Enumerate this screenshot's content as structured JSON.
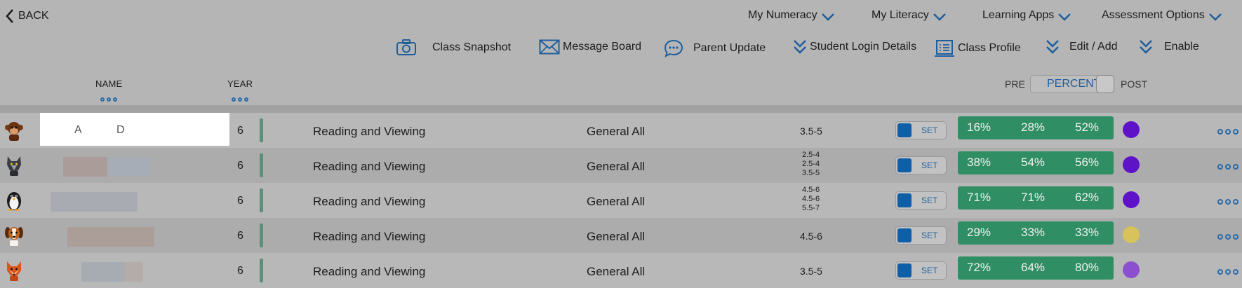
{
  "nav": {
    "back_label": "BACK"
  },
  "topmenu": [
    {
      "label": "My Numeracy"
    },
    {
      "label": "My Literacy"
    },
    {
      "label": "Learning Apps"
    },
    {
      "label": "Assessment Options"
    }
  ],
  "toolbar": [
    {
      "label": "Class Snapshot",
      "icon": "camera-icon"
    },
    {
      "label": "Message Board",
      "icon": "envelope-icon"
    },
    {
      "label": "Parent Update",
      "icon": "chat-bubble-icon"
    },
    {
      "label": "Student Login Details",
      "icon": "double-chevron-down-icon"
    },
    {
      "label": "Class Profile",
      "icon": "clipboard-list-icon"
    },
    {
      "label": "Edit / Add",
      "icon": "double-chevron-down-icon"
    },
    {
      "label": "Enable",
      "icon": "double-chevron-down-icon"
    }
  ],
  "columns": {
    "name": "NAME",
    "year": "YEAR"
  },
  "score_view": {
    "pre": "PRE",
    "mode": "PERCENT",
    "post": "POST"
  },
  "colors": {
    "accent": "#2a6ba8",
    "toggle_blue": "#0f5ea8",
    "score_green": "#2f8e63",
    "strand_bar": "#5a8f7a"
  },
  "rows": [
    {
      "avatar": "monkey-avatar",
      "name_initials": [
        "A",
        "D"
      ],
      "year": "6",
      "strand": "Reading and Viewing",
      "set": "General All",
      "levels": [
        "3.5-5"
      ],
      "toggle": "SET",
      "scores": [
        "16%",
        "28%",
        "52%"
      ],
      "status_color": "#5f13c8"
    },
    {
      "avatar": "wolf-avatar",
      "year": "6",
      "strand": "Reading and Viewing",
      "set": "General All",
      "levels": [
        "2.5-4",
        "2.5-4",
        "3.5-5"
      ],
      "toggle": "SET",
      "scores": [
        "38%",
        "54%",
        "56%"
      ],
      "status_color": "#5f13c8"
    },
    {
      "avatar": "penguin-avatar",
      "year": "6",
      "strand": "Reading and Viewing",
      "set": "General All",
      "levels": [
        "4.5-6",
        "4.5-6",
        "5.5-7"
      ],
      "toggle": "SET",
      "scores": [
        "71%",
        "71%",
        "62%"
      ],
      "status_color": "#5f13c8"
    },
    {
      "avatar": "dog-avatar",
      "year": "6",
      "strand": "Reading and Viewing",
      "set": "General All",
      "levels": [
        "4.5-6"
      ],
      "toggle": "SET",
      "scores": [
        "29%",
        "33%",
        "33%"
      ],
      "status_color": "#d7c35a"
    },
    {
      "avatar": "fox-avatar",
      "year": "6",
      "strand": "Reading and Viewing",
      "set": "General All",
      "levels": [
        "3.5-5"
      ],
      "toggle": "SET",
      "scores": [
        "72%",
        "64%",
        "80%"
      ],
      "status_color": "#8b4fd0"
    }
  ]
}
